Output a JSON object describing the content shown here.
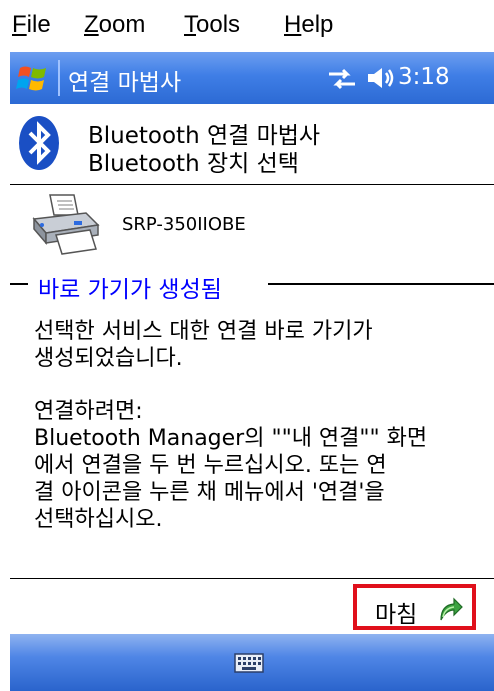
{
  "menubar": {
    "items": [
      {
        "underline": "F",
        "rest": "ile"
      },
      {
        "underline": "Z",
        "rest": "oom"
      },
      {
        "underline": "T",
        "rest": "ools"
      },
      {
        "underline": "H",
        "rest": "elp"
      }
    ]
  },
  "titlebar": {
    "title": "연결 마법사",
    "time": "3:18"
  },
  "header": {
    "line1": "Bluetooth 연결 마법사",
    "line2": "Bluetooth 장치 선택"
  },
  "device": {
    "name": "SRP-350IIOBE"
  },
  "section": {
    "title": "바로 가기가 생성됨"
  },
  "content": {
    "para1": "선택한 서비스 대한 연결 바로 가기가\n생성되었습니다.",
    "para2": "연결하려면:\nBluetooth Manager의 \"\"내 연결\"\" 화면\n에서 연결을 두 번 누르십시오. 또는 연\n결 아이콘을 누른 채 메뉴에서 '연결'을\n선택하십시오."
  },
  "buttons": {
    "done_label": "마침"
  },
  "colors": {
    "titlebar": "#3f7ee6",
    "section_title": "#0000ff",
    "highlight_box": "#e0101b"
  }
}
